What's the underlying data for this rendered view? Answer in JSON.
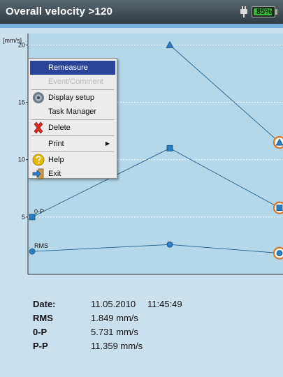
{
  "header": {
    "title": "Overall velocity >120",
    "battery_percent": "85%",
    "battery_level": 0.85,
    "plug_icon": "power-plug-icon"
  },
  "chart_data": {
    "type": "line",
    "y_unit_label": "[mm/s]",
    "ylim": [
      0,
      21
    ],
    "y_ticks": [
      5,
      10,
      15,
      20
    ],
    "x_range": [
      0,
      2
    ],
    "grid": true,
    "series": [
      {
        "name": "0-P",
        "marker": "square",
        "x": [
          0,
          1,
          2
        ],
        "values": [
          5.0,
          11.0,
          5.8
        ]
      },
      {
        "name": "RMS",
        "marker": "circle",
        "x": [
          0,
          1,
          2
        ],
        "values": [
          2.0,
          2.6,
          1.85
        ]
      },
      {
        "name": "",
        "marker": "triangle",
        "x": [
          1,
          2
        ],
        "values": [
          20.0,
          11.5
        ]
      }
    ],
    "highlighted_point_index": 2,
    "colors": {
      "plot_bg": "#b4d8ea",
      "line": "#1f5f8f",
      "marker": "#2a7fc4",
      "highlight_ring": "#e0731f",
      "grid": "#ffffff"
    }
  },
  "context_menu": {
    "items": [
      {
        "label": "Remeasure",
        "state": "selected",
        "icon": ""
      },
      {
        "label": "Event/Comment",
        "state": "disabled",
        "icon": ""
      },
      {
        "label": "Display setup",
        "state": "normal",
        "icon": "settings-disc-icon"
      },
      {
        "label": "Task Manager",
        "state": "normal",
        "icon": ""
      },
      {
        "label": "Delete",
        "state": "normal",
        "icon": "delete-x-icon"
      },
      {
        "label": "Print",
        "state": "normal",
        "icon": "",
        "submenu_glyph": "▶"
      },
      {
        "label": "Help",
        "state": "normal",
        "icon": "help-icon"
      },
      {
        "label": "Exit",
        "state": "normal",
        "icon": "exit-arrow-icon"
      }
    ]
  },
  "readings": [
    {
      "key": "Date:",
      "value": "11.05.2010",
      "time": "11:45:49"
    },
    {
      "key": "RMS",
      "value": "1.849 mm/s"
    },
    {
      "key": "0-P",
      "value": "5.731 mm/s"
    },
    {
      "key": "P-P",
      "value": "11.359 mm/s"
    }
  ]
}
